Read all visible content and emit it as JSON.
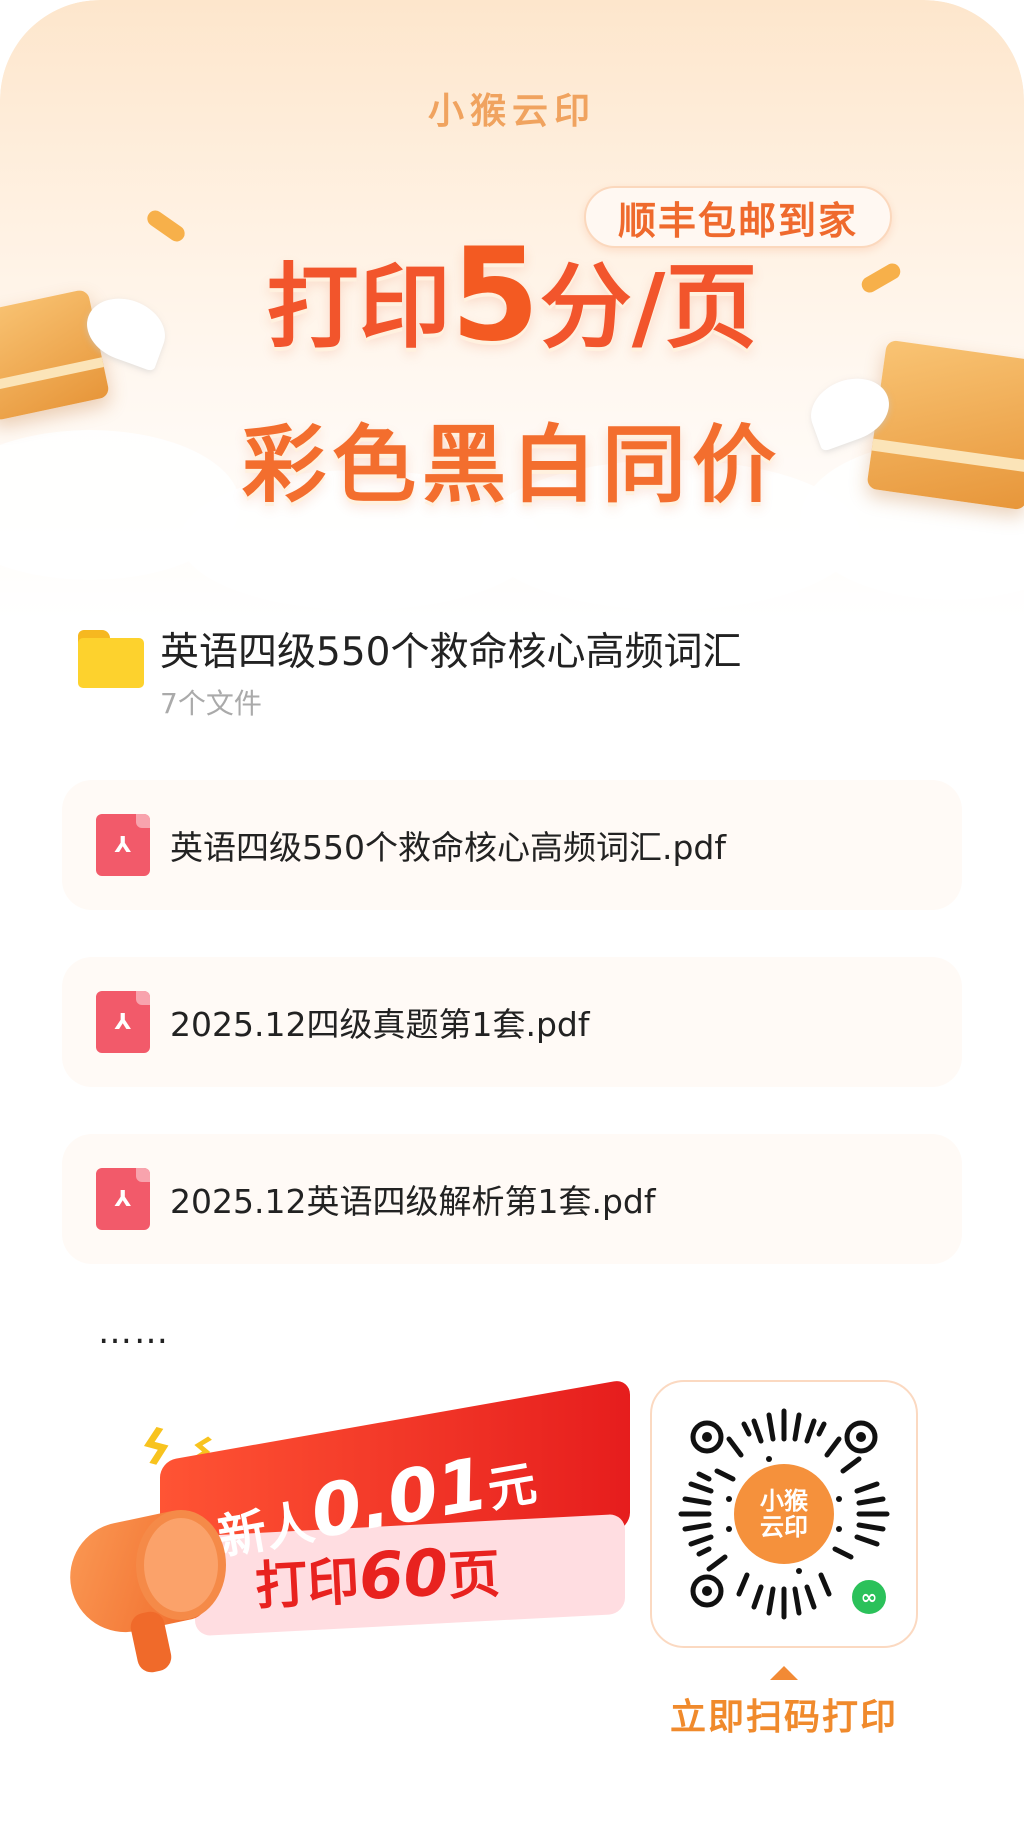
{
  "brand": {
    "name": "小猴云印"
  },
  "hero": {
    "badge": "顺丰包邮到家",
    "headline_prefix": "打印",
    "headline_number": "5",
    "headline_suffix": "分/页",
    "subheadline": "彩色黑白同价"
  },
  "folder": {
    "icon": "folder-icon",
    "title": "英语四级550个救命核心高频词汇",
    "file_count": "7个文件"
  },
  "files": [
    {
      "icon": "pdf-icon",
      "name": "英语四级550个救命核心高频词汇.pdf"
    },
    {
      "icon": "pdf-icon",
      "name": "2025.12四级真题第1套.pdf"
    },
    {
      "icon": "pdf-icon",
      "name": "2025.12英语四级解析第1套.pdf"
    }
  ],
  "more": "……",
  "promo": {
    "line1_prefix": "新人",
    "line1_amount": "0.01",
    "line1_unit": "元",
    "line2_prefix": "打印",
    "line2_amount": "60",
    "line2_unit": "页"
  },
  "qr": {
    "center_line1": "小猴",
    "center_line2": "云印",
    "caption": "立即扫码打印"
  },
  "colors": {
    "accent": "#f2552c",
    "brand_orange": "#f0a35f",
    "pdf_red": "#f25a6a",
    "folder_yellow": "#fdd22d",
    "promo_red": "#e61d1d",
    "wechat_green": "#2bc15a"
  }
}
